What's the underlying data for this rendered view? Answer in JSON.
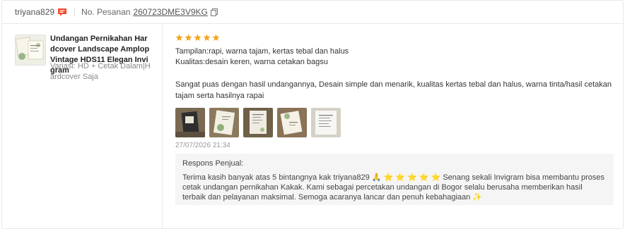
{
  "header": {
    "buyer_name": "triyana829",
    "order_label": "No. Pesanan",
    "order_number": "260723DME3V9KG"
  },
  "product": {
    "name": "Undangan Pernikahan Hardcover Landscape Amplop Vintage HDS11 Elegan Invigram",
    "variant": "Variasi: HD + Cetak Dalam|Hardcover Saja"
  },
  "review": {
    "rating": 5,
    "rating_max": 5,
    "star_color": "#f5a623",
    "aspect_1": "Tampilan:rapi, warna tajam, kertas tebal dan halus",
    "aspect_2": "Kualitas:desain keren, warna cetakan bagsu",
    "comment": "Sangat puas dengan hasil undangannya, Desain simple dan menarik, kualitas kertas tebal dan halus, warna tinta/hasil cetakan tajam serta hasilnya rapai",
    "photos": [
      "photo-1",
      "photo-2",
      "photo-3",
      "photo-4",
      "photo-5"
    ],
    "date": "27/07/2026 21:34"
  },
  "seller_reply": {
    "title": "Respons Penjual:",
    "text": "Terima kasih banyak atas 5 bintangnya kak triyana829 🙏 ⭐ ⭐ ⭐ ⭐ ⭐ Senang sekali Invigram bisa membantu proses cetak undangan pernikahan Kakak. Kami sebagai percetakan undangan di Bogor selalu berusaha memberikan hasil terbaik dan pelayanan maksimal. Semoga acaranya lancar dan penuh kebahagiaan ✨"
  },
  "colors": {
    "chat_icon": "#ee4d2d",
    "reply_bg": "#f5f5f5",
    "border": "#e8e8e8"
  },
  "icons": [
    "chat-icon",
    "copy-icon",
    "star-icon"
  ]
}
